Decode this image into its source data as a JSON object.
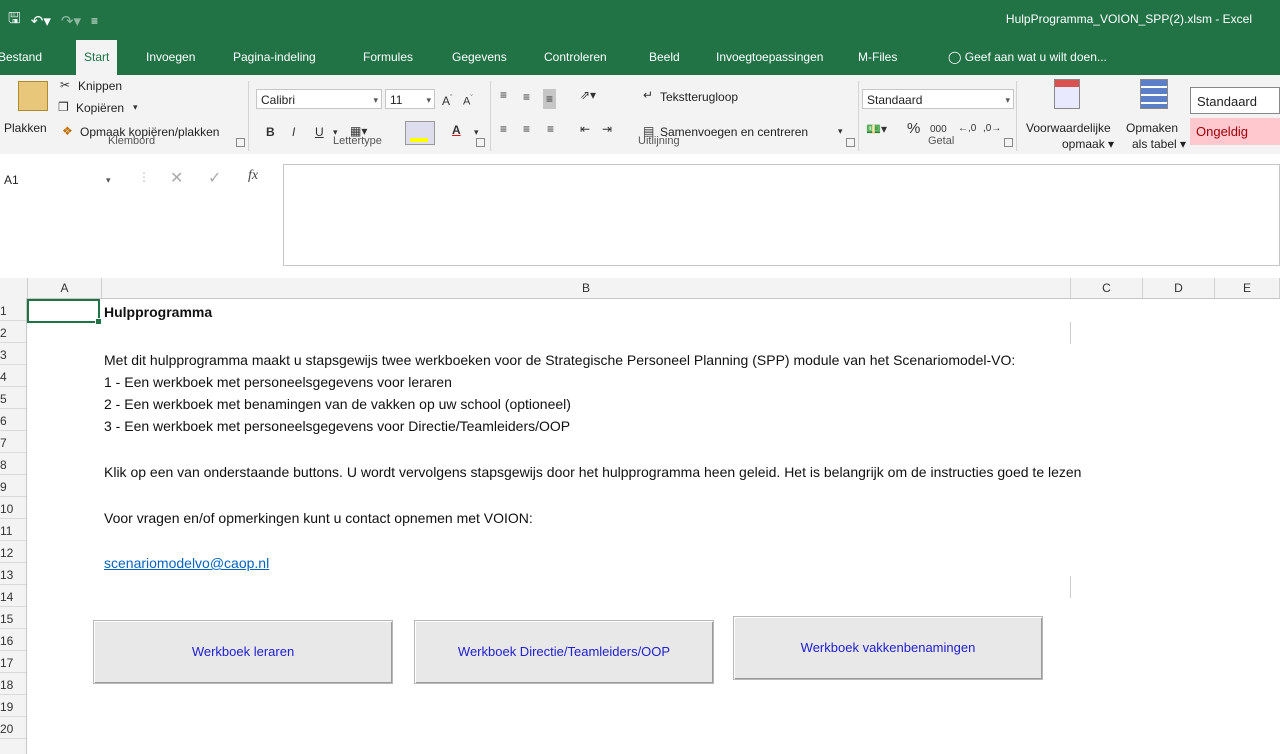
{
  "window": {
    "title": "HulpProgramma_VOION_SPP(2).xlsm - Excel"
  },
  "ribbon_tabs": [
    "Bestand",
    "Start",
    "Invoegen",
    "Pagina-indeling",
    "Formules",
    "Gegevens",
    "Controleren",
    "Beeld",
    "Invoegtoepassingen",
    "M-Files"
  ],
  "tell_me": "Geef aan wat u wilt doen...",
  "clipboard": {
    "paste": "Plakken",
    "cut": "Knippen",
    "copy": "Kopiëren",
    "format_painter": "Opmaak kopiëren/plakken",
    "group": "Klembord"
  },
  "font": {
    "name": "Calibri",
    "size": "11",
    "group": "Lettertype",
    "fill_color": "#ffff00",
    "font_color": "#ff0000"
  },
  "alignment": {
    "wrap": "Tekstterugloop",
    "merge": "Samenvoegen en centreren",
    "group": "Uitlijning"
  },
  "number": {
    "format": "Standaard",
    "percent": "%",
    "thousands": "000",
    "group": "Getal"
  },
  "styles": {
    "conditional": "Voorwaardelijke",
    "conditional2": "opmaak",
    "as_table": "Opmaken",
    "as_table2": "als tabel",
    "standard": "Standaard",
    "invalid": "Ongeldig"
  },
  "formula_bar": {
    "name_box": "A1",
    "fx": "fx",
    "value": ""
  },
  "columns": [
    "A",
    "B",
    "C",
    "D",
    "E"
  ],
  "rows": [
    "1",
    "2",
    "3",
    "4",
    "5",
    "6",
    "7",
    "8",
    "9",
    "10",
    "11",
    "12",
    "13",
    "14",
    "15",
    "16",
    "17",
    "18",
    "19",
    "20"
  ],
  "sheet": {
    "heading": "Hulpprogramma",
    "intro": "Met dit  hulpprogramma maakt u stapsgewijs  twee werkboeken voor de Strategische Personeel Planning (SPP) module van het Scenariomodel-VO:",
    "item1": "1 - Een werkboek met personeelsgegevens voor leraren",
    "item2": "2 - Een werkboek met benamingen van de vakken op uw school (optioneel)",
    "item3": "3 - Een werkboek met personeelsgegevens voor Directie/Teamleiders/OOP",
    "instruction": "Klik op een van onderstaande buttons. U wordt vervolgens stapsgewijs door het hulpprogramma heen geleid.  Het is belangrijk om de instructies goed te lezen",
    "contact": "Voor vragen en/of opmerkingen kunt u contact opnemen met VOION:",
    "email": "scenariomodelvo@caop.nl"
  },
  "buttons": {
    "teachers": "Werkboek leraren",
    "management": "Werkboek Directie/Teamleiders/OOP",
    "subjects": "Werkboek vakkenbenamingen"
  }
}
